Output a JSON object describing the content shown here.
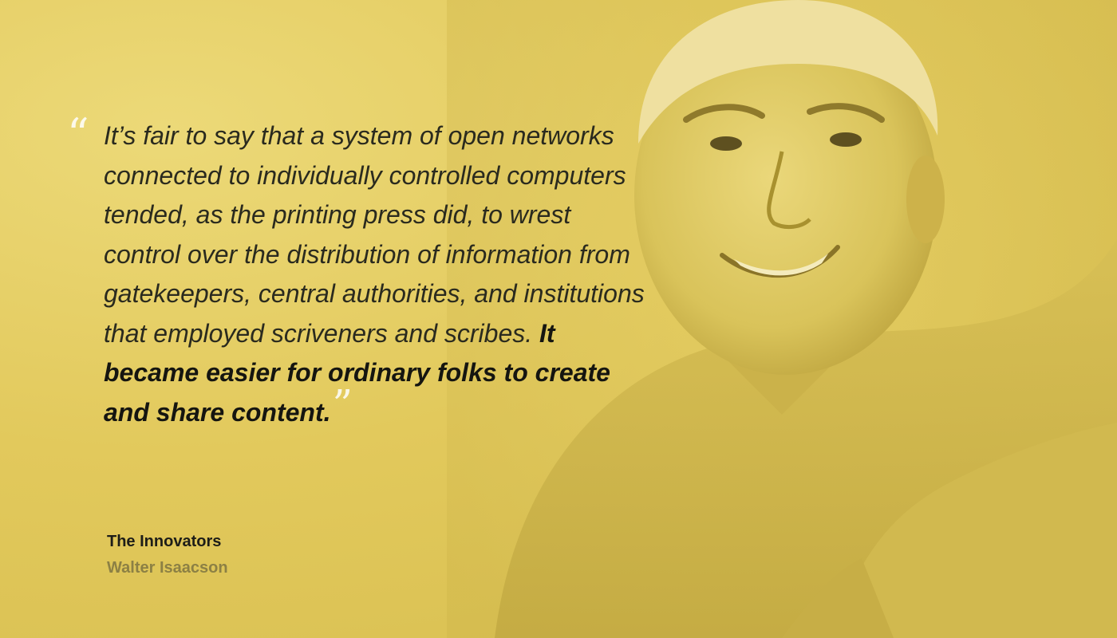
{
  "quote": {
    "open_mark": "“",
    "text_regular": "It’s fair to say that a system of open networks connected to individually controlled computers tended, as the printing press did, to wrest control over the distribution of information from gatekeepers, central authorities, and institutions that employed scriveners and scribes. ",
    "text_emphasis": "It became easier for ordinary folks to create and share content.",
    "close_mark": "”"
  },
  "source": {
    "book_title": "The Innovators",
    "author": "Walter Isaacson"
  },
  "colors": {
    "background": "#e2c95c",
    "text": "#2a2a1e",
    "quote_marks": "#ffffff",
    "author": "#8c8044"
  }
}
